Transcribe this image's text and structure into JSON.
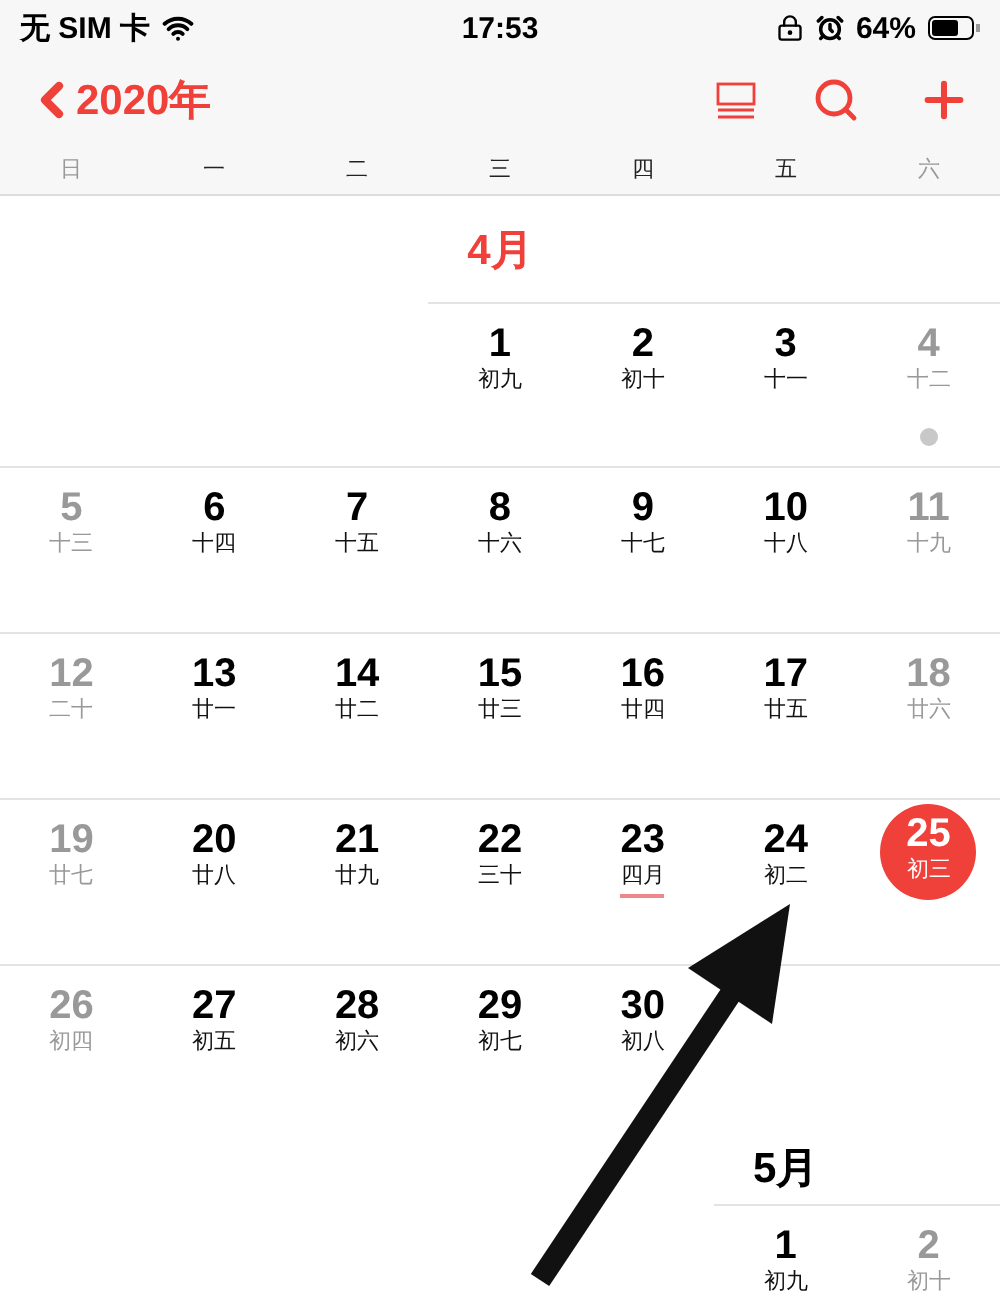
{
  "status_bar": {
    "carrier": "无 SIM 卡",
    "time": "17:53",
    "battery": "64%"
  },
  "nav": {
    "back": "2020年"
  },
  "weekdays": [
    {
      "label": "日",
      "muted": true
    },
    {
      "label": "一",
      "muted": false
    },
    {
      "label": "二",
      "muted": false
    },
    {
      "label": "三",
      "muted": false
    },
    {
      "label": "四",
      "muted": false
    },
    {
      "label": "五",
      "muted": false
    },
    {
      "label": "六",
      "muted": true
    }
  ],
  "months": [
    {
      "title": "4月",
      "weeks": [
        [
          {
            "kind": "blank"
          },
          {
            "kind": "blank"
          },
          {
            "kind": "blank"
          },
          {
            "date": "1",
            "lunar": "初九",
            "muted": false,
            "today": false,
            "event": false,
            "holiday": false
          },
          {
            "date": "2",
            "lunar": "初十",
            "muted": false,
            "today": false,
            "event": false,
            "holiday": false
          },
          {
            "date": "3",
            "lunar": "十一",
            "muted": false,
            "today": false,
            "event": false,
            "holiday": false
          },
          {
            "date": "4",
            "lunar": "十二",
            "muted": true,
            "today": false,
            "event": true,
            "holiday": false
          }
        ],
        [
          {
            "date": "5",
            "lunar": "十三",
            "muted": true,
            "today": false,
            "event": false,
            "holiday": false
          },
          {
            "date": "6",
            "lunar": "十四",
            "muted": false,
            "today": false,
            "event": false,
            "holiday": false
          },
          {
            "date": "7",
            "lunar": "十五",
            "muted": false,
            "today": false,
            "event": false,
            "holiday": false
          },
          {
            "date": "8",
            "lunar": "十六",
            "muted": false,
            "today": false,
            "event": false,
            "holiday": false
          },
          {
            "date": "9",
            "lunar": "十七",
            "muted": false,
            "today": false,
            "event": false,
            "holiday": false
          },
          {
            "date": "10",
            "lunar": "十八",
            "muted": false,
            "today": false,
            "event": false,
            "holiday": false
          },
          {
            "date": "11",
            "lunar": "十九",
            "muted": true,
            "today": false,
            "event": false,
            "holiday": false
          }
        ],
        [
          {
            "date": "12",
            "lunar": "二十",
            "muted": true,
            "today": false,
            "event": false,
            "holiday": false
          },
          {
            "date": "13",
            "lunar": "廿一",
            "muted": false,
            "today": false,
            "event": false,
            "holiday": false
          },
          {
            "date": "14",
            "lunar": "廿二",
            "muted": false,
            "today": false,
            "event": false,
            "holiday": false
          },
          {
            "date": "15",
            "lunar": "廿三",
            "muted": false,
            "today": false,
            "event": false,
            "holiday": false
          },
          {
            "date": "16",
            "lunar": "廿四",
            "muted": false,
            "today": false,
            "event": false,
            "holiday": false
          },
          {
            "date": "17",
            "lunar": "廿五",
            "muted": false,
            "today": false,
            "event": false,
            "holiday": false
          },
          {
            "date": "18",
            "lunar": "廿六",
            "muted": true,
            "today": false,
            "event": false,
            "holiday": false
          }
        ],
        [
          {
            "date": "19",
            "lunar": "廿七",
            "muted": true,
            "today": false,
            "event": false,
            "holiday": false
          },
          {
            "date": "20",
            "lunar": "廿八",
            "muted": false,
            "today": false,
            "event": false,
            "holiday": false
          },
          {
            "date": "21",
            "lunar": "廿九",
            "muted": false,
            "today": false,
            "event": false,
            "holiday": false
          },
          {
            "date": "22",
            "lunar": "三十",
            "muted": false,
            "today": false,
            "event": false,
            "holiday": false
          },
          {
            "date": "23",
            "lunar": "四月",
            "muted": false,
            "today": false,
            "event": false,
            "holiday": true
          },
          {
            "date": "24",
            "lunar": "初二",
            "muted": false,
            "today": false,
            "event": false,
            "holiday": false
          },
          {
            "date": "25",
            "lunar": "初三",
            "muted": true,
            "today": true,
            "event": false,
            "holiday": false
          }
        ],
        [
          {
            "date": "26",
            "lunar": "初四",
            "muted": true,
            "today": false,
            "event": false,
            "holiday": false
          },
          {
            "date": "27",
            "lunar": "初五",
            "muted": false,
            "today": false,
            "event": false,
            "holiday": false
          },
          {
            "date": "28",
            "lunar": "初六",
            "muted": false,
            "today": false,
            "event": false,
            "holiday": false
          },
          {
            "date": "29",
            "lunar": "初七",
            "muted": false,
            "today": false,
            "event": false,
            "holiday": false
          },
          {
            "date": "30",
            "lunar": "初八",
            "muted": false,
            "today": false,
            "event": false,
            "holiday": false
          }
        ]
      ]
    },
    {
      "title": "5月",
      "weeks": [
        [
          {
            "kind": "blank"
          },
          {
            "kind": "blank"
          },
          {
            "kind": "blank"
          },
          {
            "kind": "blank"
          },
          {
            "kind": "blank"
          },
          {
            "date": "1",
            "lunar": "初九",
            "muted": false,
            "today": false,
            "event": false,
            "holiday": false
          },
          {
            "date": "2",
            "lunar": "初十",
            "muted": true,
            "today": false,
            "event": false,
            "holiday": false
          }
        ]
      ]
    }
  ]
}
